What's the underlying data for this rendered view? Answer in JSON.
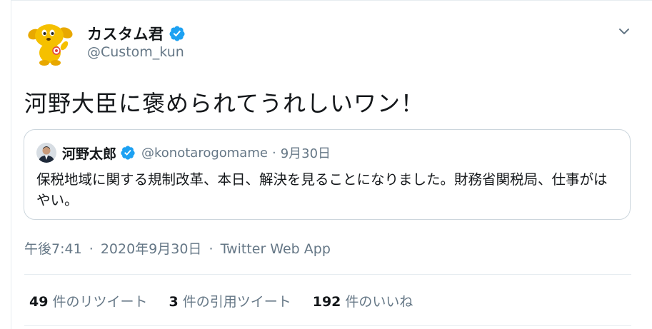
{
  "author": {
    "display_name": "カスタム君",
    "handle": "@Custom_kun",
    "verified_icon": "verified-badge-icon"
  },
  "tweet": {
    "text": "河野大臣に褒められてうれしいワン！"
  },
  "quoted": {
    "display_name": "河野太郎",
    "handle": "@konotarogomame",
    "separator": "·",
    "date": "9月30日",
    "text": "保税地域に関する規制改革、本日、解決を見ることになりました。財務省関税局、仕事がはやい。"
  },
  "meta": {
    "time": "午後7:41",
    "date": "2020年9月30日",
    "separator": "·",
    "source": "Twitter Web App"
  },
  "stats": {
    "retweets_count": "49",
    "retweets_label": "件のリツイート",
    "quotes_count": "3",
    "quotes_label": "件の引用ツイート",
    "likes_count": "192",
    "likes_label": "件のいいね"
  },
  "colors": {
    "accent": "#1da1f2",
    "text_primary": "#14171a",
    "text_secondary": "#657786",
    "border": "#ccd6dd"
  }
}
